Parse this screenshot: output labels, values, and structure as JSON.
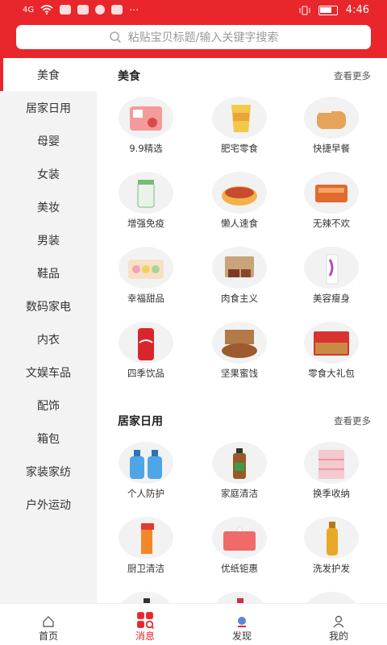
{
  "status_bar": {
    "signal": "4G",
    "time": "4:46"
  },
  "search": {
    "placeholder": "粘贴宝贝标题/输入关键字搜索"
  },
  "sidebar": {
    "items": [
      {
        "label": "美食",
        "active": true
      },
      {
        "label": "居家日用"
      },
      {
        "label": "母婴"
      },
      {
        "label": "女装"
      },
      {
        "label": "美妆"
      },
      {
        "label": "男装"
      },
      {
        "label": "鞋品"
      },
      {
        "label": "数码家电"
      },
      {
        "label": "内衣"
      },
      {
        "label": "文娱车品"
      },
      {
        "label": "配饰"
      },
      {
        "label": "箱包"
      },
      {
        "label": "家装家纺"
      },
      {
        "label": "户外运动"
      }
    ]
  },
  "sections": [
    {
      "title": "美食",
      "more": "查看更多",
      "items": [
        {
          "label": "9.9精选",
          "icon": "snack-box-icon"
        },
        {
          "label": "肥宅零食",
          "icon": "chips-bag-icon"
        },
        {
          "label": "快捷早餐",
          "icon": "bread-icon"
        },
        {
          "label": "增强免疫",
          "icon": "supplement-jar-icon"
        },
        {
          "label": "懒人速食",
          "icon": "noodle-bowl-icon"
        },
        {
          "label": "无辣不欢",
          "icon": "spicy-strips-icon"
        },
        {
          "label": "幸福甜品",
          "icon": "macaron-icon"
        },
        {
          "label": "肉食主义",
          "icon": "meat-icon"
        },
        {
          "label": "美容瘦身",
          "icon": "slim-drink-icon"
        },
        {
          "label": "四季饮品",
          "icon": "cola-can-icon"
        },
        {
          "label": "坚果蜜饯",
          "icon": "nuts-icon"
        },
        {
          "label": "零食大礼包",
          "icon": "gift-box-icon"
        }
      ]
    },
    {
      "title": "居家日用",
      "more": "查看更多",
      "items": [
        {
          "label": "个人防护",
          "icon": "sanitizer-bottles-icon"
        },
        {
          "label": "家庭清洁",
          "icon": "disinfectant-bottle-icon"
        },
        {
          "label": "换季收纳",
          "icon": "storage-drawer-icon"
        },
        {
          "label": "厨卫清洁",
          "icon": "spray-cleaner-icon"
        },
        {
          "label": "优纸钜惠",
          "icon": "tissue-box-icon"
        },
        {
          "label": "洗发护发",
          "icon": "shampoo-bottle-icon"
        },
        {
          "label": "",
          "icon": "lotion-bottle-icon"
        },
        {
          "label": "",
          "icon": "cosmetic-bottle-icon"
        },
        {
          "label": "",
          "icon": "sanitary-pad-icon"
        }
      ]
    }
  ],
  "bottom_nav": [
    {
      "label": "首页",
      "icon": "home-icon"
    },
    {
      "label": "消息",
      "icon": "message-grid-icon",
      "active": true
    },
    {
      "label": "发现",
      "icon": "discover-icon"
    },
    {
      "label": "我的",
      "icon": "profile-icon"
    }
  ],
  "colors": {
    "accent": "#e9262b",
    "sidebar_bg": "#f3f3f3"
  }
}
